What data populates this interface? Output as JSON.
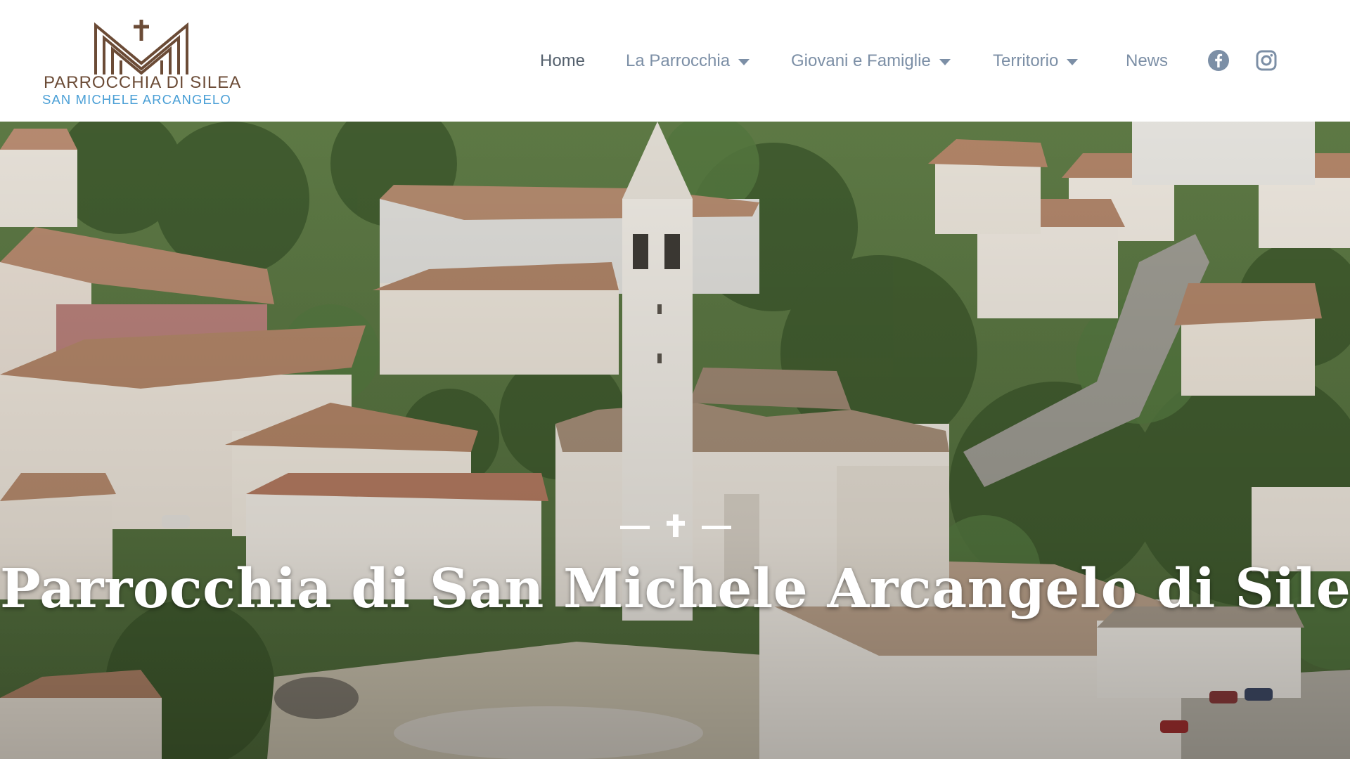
{
  "header": {
    "logo": {
      "line1": "PARROCCHIA DI SILEA",
      "line2": "SAN MICHELE ARCANGELO",
      "colors": {
        "mark": "#6b4b36",
        "line1": "#6b4b36",
        "line2": "#4a9fd6"
      }
    },
    "nav": {
      "items": [
        {
          "label": "Home",
          "active": true,
          "has_dropdown": false
        },
        {
          "label": "La Parrocchia",
          "active": false,
          "has_dropdown": true
        },
        {
          "label": "Giovani e Famiglie",
          "active": false,
          "has_dropdown": true
        },
        {
          "label": "Territorio",
          "active": false,
          "has_dropdown": true
        },
        {
          "label": "News",
          "active": false,
          "has_dropdown": false
        }
      ],
      "colors": {
        "active": "#54606d",
        "default": "#7c8fa6"
      }
    },
    "social": [
      {
        "icon": "facebook-icon"
      },
      {
        "icon": "instagram-icon"
      }
    ]
  },
  "hero": {
    "image": "aerial-view-church-bell-tower-town",
    "ornament": "cross-divider",
    "title": "Parrocchia di San Michele Arcangelo di Silea",
    "title_color": "#ffffff"
  }
}
